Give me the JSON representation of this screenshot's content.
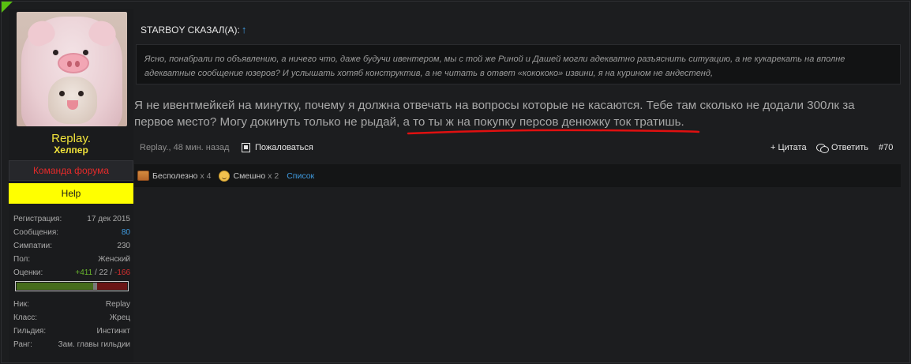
{
  "user": {
    "name": "Replay.",
    "title": "Хелпер",
    "team_banner": "Команда форума",
    "help_banner": "Help",
    "info": [
      {
        "label": "Регистрация:",
        "value": "17 дек 2015"
      },
      {
        "label": "Сообщения:",
        "value": "80"
      },
      {
        "label": "Симпатии:",
        "value": "230"
      },
      {
        "label": "Пол:",
        "value": "Женский"
      }
    ],
    "ratings": {
      "label": "Оценки:",
      "positive": "+411",
      "neutral": "22",
      "negative": "-166",
      "sep": " / "
    },
    "rating_fraction": {
      "positive": 0.69,
      "neutral": 0.04,
      "negative": 0.27
    },
    "game_info": [
      {
        "label": "Ник:",
        "value": "Replay"
      },
      {
        "label": "Класс:",
        "value": "Жрец"
      },
      {
        "label": "Гильдия:",
        "value": "Инстинкт"
      },
      {
        "label": "Ранг:",
        "value": "Зам. главы гильдии"
      }
    ]
  },
  "post": {
    "quote_author": "STARBOY СКАЗАЛ(А):",
    "quote_arrow": "↑",
    "quote_text": "Ясно, понабрали по объявлению, а ничего что, даже будучи ивентером, мы с той же Риной и Дашей могли адекватно разъяснить ситуацию, а не кукарекать на вполне адекватные сообщение юзеров? И услышать хотяб конструктив, а не читать в ответ «кокококо» извини, я на курином не андестенд,",
    "text_line1": "Я не ивентмейкей на минутку, почему я должна отвечать на вопросы которые не касаются. Тебе там сколько не додали 300лк за",
    "text_line2_a": "первое место? Могу докинуть только не рыдай, ",
    "text_line2_b": "а то ты ж на покупку персов денюжку ток тратишь.",
    "meta_author_time": "Replay., 48 мин. назад",
    "report_label": "Пожаловаться",
    "quote_action": "+ Цитата",
    "reply_action": "Ответить",
    "post_number": "#70"
  },
  "likes": {
    "useless_label": "Бесполезно",
    "useless_count": "x 4",
    "funny_label": "Смешно",
    "funny_count": "x 2",
    "list_link": "Список"
  },
  "colors": {
    "accent_green": "#58c010",
    "username_yellow": "#f2e43b",
    "team_red": "#e52a2a",
    "help_yellow": "#ffff00",
    "link_blue": "#3f9be0",
    "underline_red": "#e01010"
  }
}
